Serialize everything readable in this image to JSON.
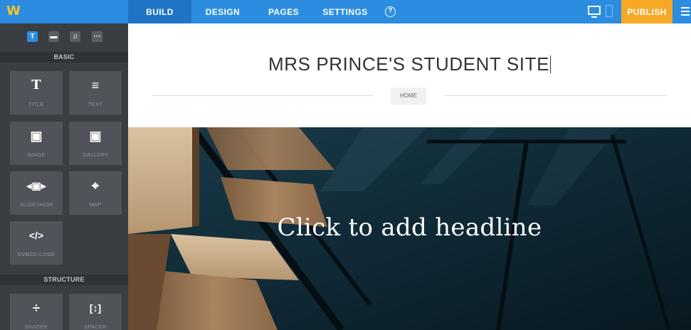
{
  "app": {
    "logo": "W"
  },
  "nav": {
    "items": [
      {
        "label": "BUILD"
      },
      {
        "label": "DESIGN"
      },
      {
        "label": "PAGES"
      },
      {
        "label": "SETTINGS"
      }
    ],
    "help_icon": "?",
    "publish_label": "PUBLISH",
    "active": "BUILD"
  },
  "sidebar": {
    "tabs": [
      {
        "icon": "text-icon",
        "glyph": "T"
      },
      {
        "icon": "layout-icon",
        "glyph": "▬"
      },
      {
        "icon": "music-icon",
        "glyph": "♫"
      },
      {
        "icon": "more-icon",
        "glyph": "···"
      }
    ],
    "basic_header": "BASIC",
    "basic_items": [
      {
        "label": "TITLE",
        "icon": "title-icon",
        "glyph": "T"
      },
      {
        "label": "TEXT",
        "icon": "text-icon",
        "glyph": "≡"
      },
      {
        "label": "IMAGE",
        "icon": "image-icon",
        "glyph": "▣"
      },
      {
        "label": "GALLERY",
        "icon": "gallery-icon",
        "glyph": "▣"
      },
      {
        "label": "SLIDESHOW",
        "icon": "slideshow-icon",
        "glyph": "◂▣▸"
      },
      {
        "label": "MAP",
        "icon": "map-pin-icon",
        "glyph": "⌖"
      },
      {
        "label": "EMBED CODE",
        "icon": "code-icon",
        "glyph": "</>"
      }
    ],
    "structure_header": "STRUCTURE",
    "structure_items": [
      {
        "label": "DIVIDER",
        "icon": "divider-icon",
        "glyph": "÷"
      },
      {
        "label": "SPACER",
        "icon": "spacer-icon",
        "glyph": "[↕]"
      }
    ]
  },
  "site": {
    "title": "MRS PRINCE'S STUDENT SITE",
    "nav_home": "HOME",
    "headline": "Click to add headline"
  },
  "colors": {
    "accent": "#2c8de0",
    "publish": "#f7a826",
    "logo": "#f7c322",
    "sidebar": "#3a3d42"
  }
}
